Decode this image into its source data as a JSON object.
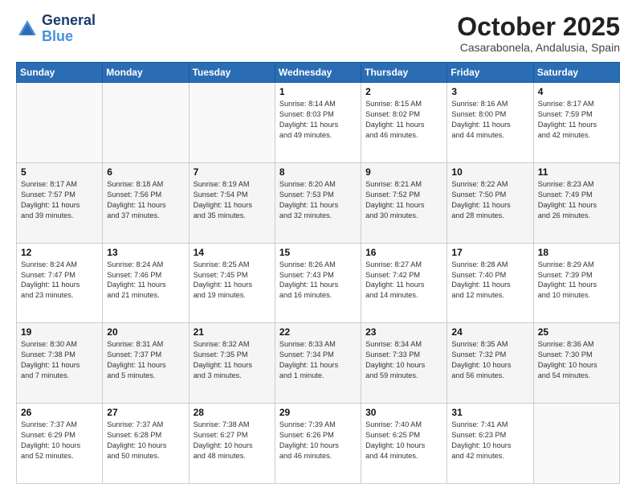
{
  "header": {
    "logo_line1": "General",
    "logo_line2": "Blue",
    "month": "October 2025",
    "location": "Casarabonela, Andalusia, Spain"
  },
  "weekdays": [
    "Sunday",
    "Monday",
    "Tuesday",
    "Wednesday",
    "Thursday",
    "Friday",
    "Saturday"
  ],
  "weeks": [
    [
      {
        "day": "",
        "info": ""
      },
      {
        "day": "",
        "info": ""
      },
      {
        "day": "",
        "info": ""
      },
      {
        "day": "1",
        "info": "Sunrise: 8:14 AM\nSunset: 8:03 PM\nDaylight: 11 hours\nand 49 minutes."
      },
      {
        "day": "2",
        "info": "Sunrise: 8:15 AM\nSunset: 8:02 PM\nDaylight: 11 hours\nand 46 minutes."
      },
      {
        "day": "3",
        "info": "Sunrise: 8:16 AM\nSunset: 8:00 PM\nDaylight: 11 hours\nand 44 minutes."
      },
      {
        "day": "4",
        "info": "Sunrise: 8:17 AM\nSunset: 7:59 PM\nDaylight: 11 hours\nand 42 minutes."
      }
    ],
    [
      {
        "day": "5",
        "info": "Sunrise: 8:17 AM\nSunset: 7:57 PM\nDaylight: 11 hours\nand 39 minutes."
      },
      {
        "day": "6",
        "info": "Sunrise: 8:18 AM\nSunset: 7:56 PM\nDaylight: 11 hours\nand 37 minutes."
      },
      {
        "day": "7",
        "info": "Sunrise: 8:19 AM\nSunset: 7:54 PM\nDaylight: 11 hours\nand 35 minutes."
      },
      {
        "day": "8",
        "info": "Sunrise: 8:20 AM\nSunset: 7:53 PM\nDaylight: 11 hours\nand 32 minutes."
      },
      {
        "day": "9",
        "info": "Sunrise: 8:21 AM\nSunset: 7:52 PM\nDaylight: 11 hours\nand 30 minutes."
      },
      {
        "day": "10",
        "info": "Sunrise: 8:22 AM\nSunset: 7:50 PM\nDaylight: 11 hours\nand 28 minutes."
      },
      {
        "day": "11",
        "info": "Sunrise: 8:23 AM\nSunset: 7:49 PM\nDaylight: 11 hours\nand 26 minutes."
      }
    ],
    [
      {
        "day": "12",
        "info": "Sunrise: 8:24 AM\nSunset: 7:47 PM\nDaylight: 11 hours\nand 23 minutes."
      },
      {
        "day": "13",
        "info": "Sunrise: 8:24 AM\nSunset: 7:46 PM\nDaylight: 11 hours\nand 21 minutes."
      },
      {
        "day": "14",
        "info": "Sunrise: 8:25 AM\nSunset: 7:45 PM\nDaylight: 11 hours\nand 19 minutes."
      },
      {
        "day": "15",
        "info": "Sunrise: 8:26 AM\nSunset: 7:43 PM\nDaylight: 11 hours\nand 16 minutes."
      },
      {
        "day": "16",
        "info": "Sunrise: 8:27 AM\nSunset: 7:42 PM\nDaylight: 11 hours\nand 14 minutes."
      },
      {
        "day": "17",
        "info": "Sunrise: 8:28 AM\nSunset: 7:40 PM\nDaylight: 11 hours\nand 12 minutes."
      },
      {
        "day": "18",
        "info": "Sunrise: 8:29 AM\nSunset: 7:39 PM\nDaylight: 11 hours\nand 10 minutes."
      }
    ],
    [
      {
        "day": "19",
        "info": "Sunrise: 8:30 AM\nSunset: 7:38 PM\nDaylight: 11 hours\nand 7 minutes."
      },
      {
        "day": "20",
        "info": "Sunrise: 8:31 AM\nSunset: 7:37 PM\nDaylight: 11 hours\nand 5 minutes."
      },
      {
        "day": "21",
        "info": "Sunrise: 8:32 AM\nSunset: 7:35 PM\nDaylight: 11 hours\nand 3 minutes."
      },
      {
        "day": "22",
        "info": "Sunrise: 8:33 AM\nSunset: 7:34 PM\nDaylight: 11 hours\nand 1 minute."
      },
      {
        "day": "23",
        "info": "Sunrise: 8:34 AM\nSunset: 7:33 PM\nDaylight: 10 hours\nand 59 minutes."
      },
      {
        "day": "24",
        "info": "Sunrise: 8:35 AM\nSunset: 7:32 PM\nDaylight: 10 hours\nand 56 minutes."
      },
      {
        "day": "25",
        "info": "Sunrise: 8:36 AM\nSunset: 7:30 PM\nDaylight: 10 hours\nand 54 minutes."
      }
    ],
    [
      {
        "day": "26",
        "info": "Sunrise: 7:37 AM\nSunset: 6:29 PM\nDaylight: 10 hours\nand 52 minutes."
      },
      {
        "day": "27",
        "info": "Sunrise: 7:37 AM\nSunset: 6:28 PM\nDaylight: 10 hours\nand 50 minutes."
      },
      {
        "day": "28",
        "info": "Sunrise: 7:38 AM\nSunset: 6:27 PM\nDaylight: 10 hours\nand 48 minutes."
      },
      {
        "day": "29",
        "info": "Sunrise: 7:39 AM\nSunset: 6:26 PM\nDaylight: 10 hours\nand 46 minutes."
      },
      {
        "day": "30",
        "info": "Sunrise: 7:40 AM\nSunset: 6:25 PM\nDaylight: 10 hours\nand 44 minutes."
      },
      {
        "day": "31",
        "info": "Sunrise: 7:41 AM\nSunset: 6:23 PM\nDaylight: 10 hours\nand 42 minutes."
      },
      {
        "day": "",
        "info": ""
      }
    ]
  ]
}
